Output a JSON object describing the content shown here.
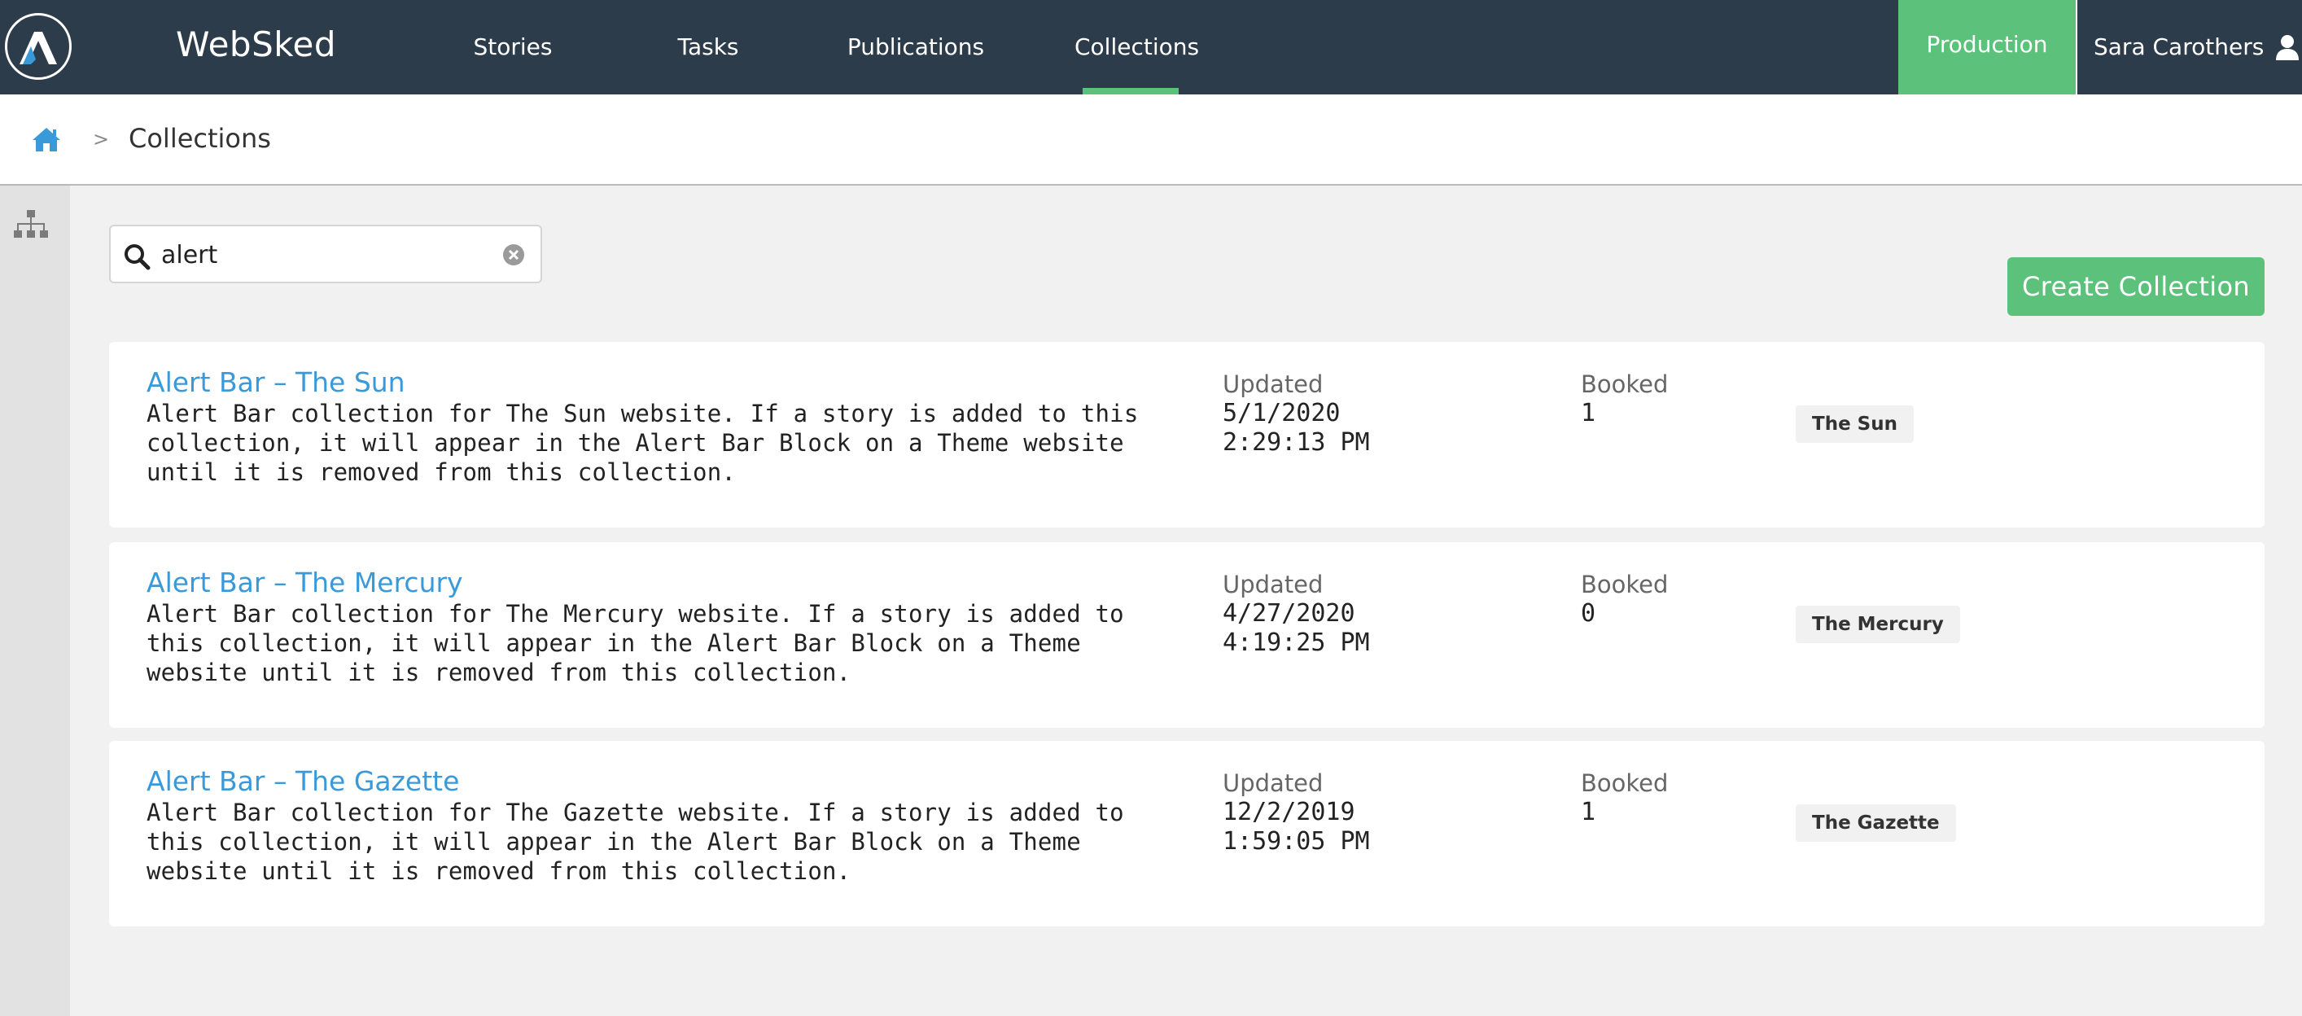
{
  "app": {
    "title": "WebSked"
  },
  "nav": {
    "items": [
      {
        "label": "Stories",
        "active": false
      },
      {
        "label": "Tasks",
        "active": false
      },
      {
        "label": "Publications",
        "active": false
      },
      {
        "label": "Collections",
        "active": true
      }
    ],
    "environment": "Production",
    "user": "Sara Carothers"
  },
  "breadcrumb": {
    "separator": ">",
    "current": "Collections"
  },
  "search": {
    "value": "alert"
  },
  "actions": {
    "create_label": "Create Collection"
  },
  "collections": [
    {
      "title": "Alert Bar – The Sun",
      "description": "Alert Bar collection for The Sun website. If a story is added to this collection, it will appear in the Alert Bar Block on a Theme website until it is removed from this collection.",
      "updated_label": "Updated",
      "updated": "5/1/2020\n2:29:13 PM",
      "booked_label": "Booked",
      "booked": "1",
      "tag": "The Sun"
    },
    {
      "title": "Alert Bar – The Mercury",
      "description": "Alert Bar collection for The Mercury website. If a story is added to this collection, it will appear in the Alert Bar Block on a Theme website until it is removed from this collection.",
      "updated_label": "Updated",
      "updated": "4/27/2020\n4:19:25 PM",
      "booked_label": "Booked",
      "booked": "0",
      "tag": "The Mercury"
    },
    {
      "title": "Alert Bar – The Gazette",
      "description": "Alert Bar collection for The Gazette website. If a story is added to this collection, it will appear in the Alert Bar Block on a Theme website until it is removed from this collection.",
      "updated_label": "Updated",
      "updated": "12/2/2019\n1:59:05 PM",
      "booked_label": "Booked",
      "booked": "1",
      "tag": "The Gazette"
    }
  ],
  "colors": {
    "nav_bg": "#2d3c4b",
    "accent_green": "#5cc17a",
    "link_blue": "#3a9ad9"
  },
  "icons": {
    "logo": "arc-logo-icon",
    "user": "user-icon",
    "home": "home-icon",
    "sitemap": "sitemap-icon",
    "search": "search-icon",
    "clear": "clear-icon"
  }
}
